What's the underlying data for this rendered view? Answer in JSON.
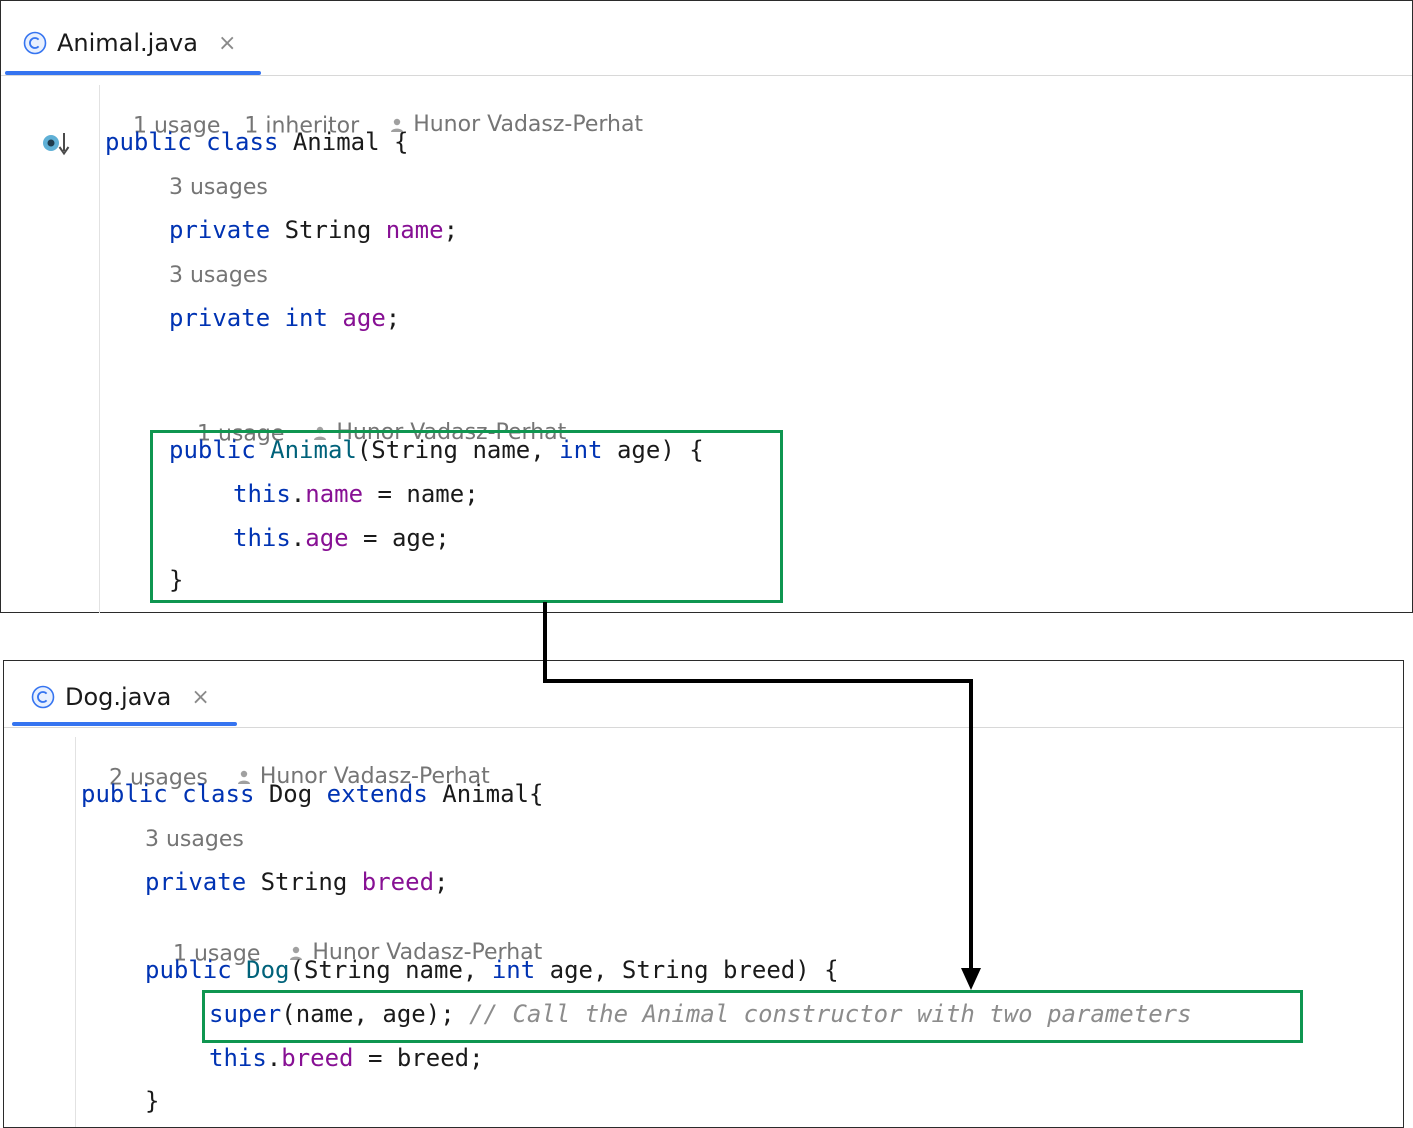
{
  "animal_panel": {
    "tab": {
      "label": "Animal.java",
      "close": "×"
    },
    "class_hint": {
      "usages": "1 usage",
      "inheritors": "1 inheritor",
      "author": "Hunor Vadasz-Perhat"
    },
    "class_decl": {
      "kw1": "public",
      "kw2": "class",
      "name": "Animal",
      "brace": "{"
    },
    "field_name_hint": "3 usages",
    "field_name": {
      "kw": "private",
      "type": "String",
      "name": "name",
      "end": ";"
    },
    "field_age_hint": "3 usages",
    "field_age": {
      "kw": "private",
      "type": "int",
      "name": "age",
      "end": ";"
    },
    "ctor_hint": {
      "usages": "1 usage",
      "author": "Hunor Vadasz-Perhat"
    },
    "ctor_decl": {
      "kw": "public",
      "name": "Animal",
      "p1": "(String name, ",
      "kw_int": "int",
      "p2": " age) {"
    },
    "assign_name": {
      "this": "this",
      "dot": ".",
      "field": "name",
      "rest": " = name;"
    },
    "assign_age": {
      "this": "this",
      "dot": ".",
      "field": "age",
      "rest": " = age;"
    },
    "close_brace": "}"
  },
  "dog_panel": {
    "tab": {
      "label": "Dog.java",
      "close": "×"
    },
    "class_hint": {
      "usages": "2 usages",
      "author": "Hunor Vadasz-Perhat"
    },
    "class_decl": {
      "kw1": "public",
      "kw2": "class",
      "name": "Dog",
      "kw3": "extends",
      "parent": "Animal{"
    },
    "field_breed_hint": "3 usages",
    "field_breed": {
      "kw": "private",
      "type": "String",
      "name": "breed",
      "end": ";"
    },
    "ctor_hint": {
      "usages": "1 usage",
      "author": "Hunor Vadasz-Perhat"
    },
    "ctor_decl": {
      "kw": "public",
      "name": "Dog",
      "p1": "(String name, ",
      "kw_int": "int",
      "p2": " age, String breed) {"
    },
    "super_call": {
      "kw": "super",
      "args": "(name, age); ",
      "comment": "// Call the Animal constructor with two parameters"
    },
    "assign_breed": {
      "this": "this",
      "dot": ".",
      "field": "breed",
      "rest": " = breed;"
    },
    "close_brace": "}"
  },
  "icons": {
    "tab_class_icon": "class-c-icon",
    "gutter": "implemented-down-arrow-icon",
    "author": "person-icon",
    "close": "close-icon"
  },
  "colors": {
    "keyword": "#0033b3",
    "field": "#871094",
    "constructor": "#00627a",
    "comment": "#8c8c8c",
    "highlight_border": "#0f9650",
    "tab_underline": "#3574f0"
  }
}
